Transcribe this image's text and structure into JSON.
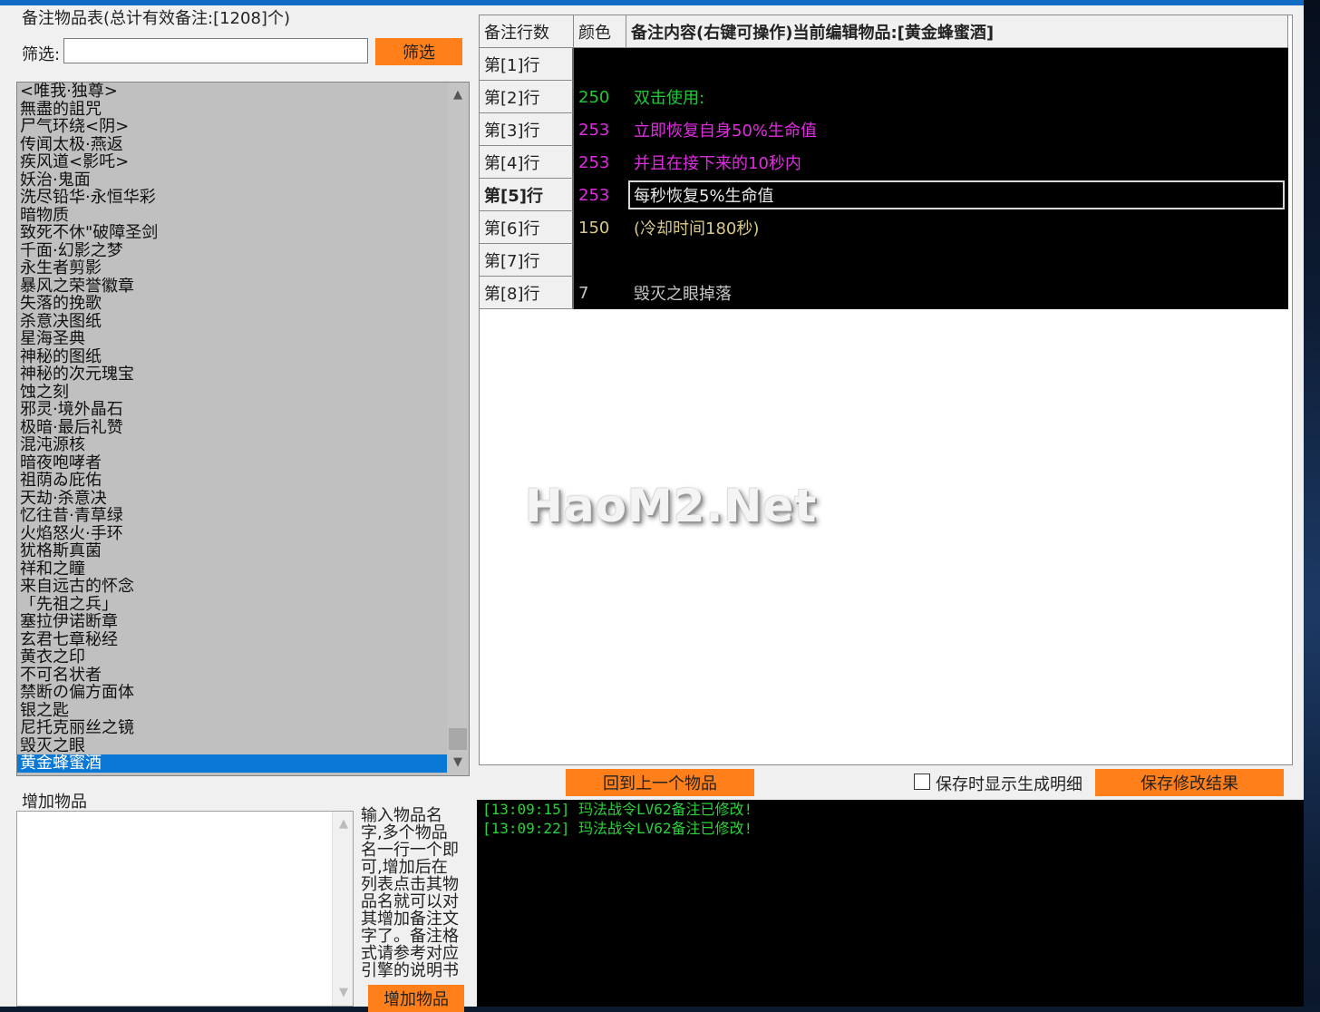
{
  "left_panel": {
    "group_title": "备注物品表(总计有效备注:[1208]个)",
    "filter_label": "筛选:",
    "filter_value": "",
    "filter_button": "筛选",
    "items": [
      "<唯我·独尊>",
      "無盡的詛咒",
      "尸气环绕<阴>",
      "传闻太极·燕返",
      "疾风道<影吒>",
      "妖治·鬼面",
      "洗尽铅华·永恒华彩",
      "暗物质",
      "致死不休\"破障圣剑",
      "千面·幻影之梦",
      "永生者剪影",
      "暴风之荣誉徽章",
      "失落的挽歌",
      "杀意决图纸",
      "星海圣典",
      "神秘的图纸",
      "神秘的次元瑰宝",
      "蚀之刻",
      "邪灵·境外晶石",
      "极暗·最后礼赞",
      "混沌源核",
      "暗夜咆哮者",
      "祖荫ゐ庇佑",
      "天劫·杀意决",
      "忆往昔·青草绿",
      "火焰怒火·手环",
      "犹格斯真菌",
      "祥和之瞳",
      "来自远古的怀念",
      "「先祖之兵」",
      "塞拉伊诺断章",
      "玄君七章秘经",
      "黄衣之印",
      "不可名状者",
      "禁断の偏方面体",
      "银之匙",
      "尼托克丽丝之镜",
      "毁灭之眼",
      "黄金蜂蜜酒"
    ],
    "selected_item": "黄金蜂蜜酒",
    "add_title": "增加物品",
    "add_value": "",
    "add_hint": "输入物品名字,多个物品名一行一个即可,增加后在列表点击其物品名就可以对其增加备注文字了。备注格式请参考对应引擎的说明书",
    "add_button": "增加物品"
  },
  "grid": {
    "headers": [
      "备注行数",
      "颜色",
      "备注内容(右键可操作)当前编辑物品:[黄金蜂蜜酒]"
    ],
    "rows": [
      {
        "label": "第[1]行",
        "color": "",
        "text": "",
        "hex": "#ffffff"
      },
      {
        "label": "第[2]行",
        "color": "250",
        "text": "双击使用:",
        "hex": "#22c83a"
      },
      {
        "label": "第[3]行",
        "color": "253",
        "text": "立即恢复自身50%生命值",
        "hex": "#e02ce0"
      },
      {
        "label": "第[4]行",
        "color": "253",
        "text": "并且在接下来的10秒内",
        "hex": "#e02ce0"
      },
      {
        "label": "第[5]行",
        "color": "253",
        "text": "每秒恢复5%生命值",
        "hex": "#e02ce0",
        "text_hex": "#e8e8e8",
        "active": true
      },
      {
        "label": "第[6]行",
        "color": "150",
        "text": "  (冷却时间180秒)",
        "hex": "#d8c88a"
      },
      {
        "label": "第[7]行",
        "color": "",
        "text": "",
        "hex": "#ffffff"
      },
      {
        "label": "第[8]行",
        "color": "7",
        "text": "毁灭之眼掉落",
        "hex": "#c8c8c8"
      }
    ]
  },
  "watermark": "HaoM2.Net",
  "bottom": {
    "prev_button": "回到上一个物品",
    "checkbox_label": "保存时显示生成明细",
    "checkbox_checked": false,
    "save_button": "保存修改结果"
  },
  "log": [
    "[13:09:15] 玛法战令LV62备注已修改!",
    "[13:09:22] 玛法战令LV62备注已修改!"
  ]
}
